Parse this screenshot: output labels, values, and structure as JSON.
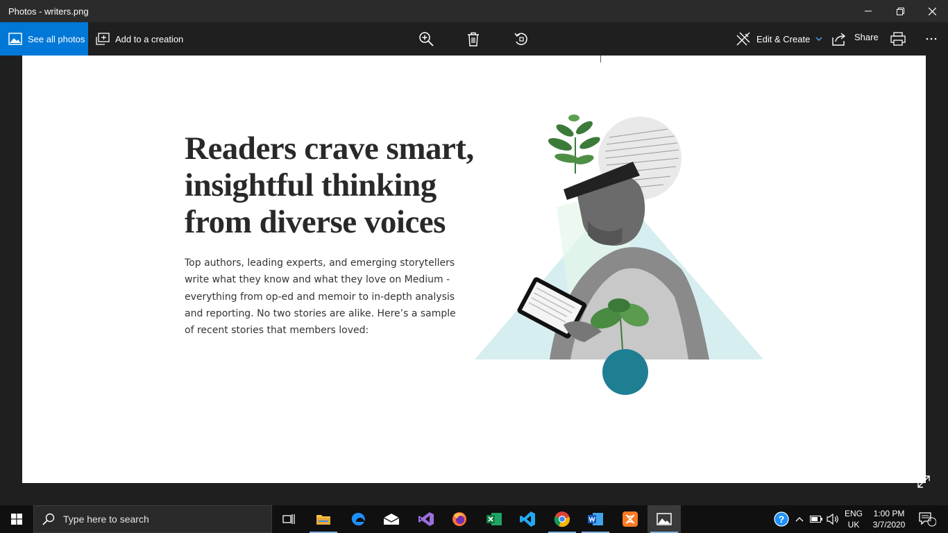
{
  "window": {
    "title": "Photos - writers.png"
  },
  "toolbar": {
    "see_all": "See all photos",
    "add_creation": "Add to a creation",
    "edit_create": "Edit & Create",
    "share": "Share"
  },
  "image": {
    "headline_lines": [
      "Readers crave smart,",
      "insightful thinking",
      "from diverse voices"
    ],
    "body": "Top authors, leading experts, and emerging storytellers write what they know and what they love on Medium - everything from op-ed and memoir to in-depth analysis and reporting. No two stories are alike. Here’s a sample of recent stories that members loved:"
  },
  "taskbar": {
    "search_placeholder": "Type here to search",
    "lang_top": "ENG",
    "lang_bottom": "UK",
    "time": "1:00 PM",
    "date": "3/7/2020",
    "notification_count": "3"
  },
  "colors": {
    "accent": "#0078d7",
    "triangle": "#d6eef0",
    "circle": "#1e7f93"
  }
}
